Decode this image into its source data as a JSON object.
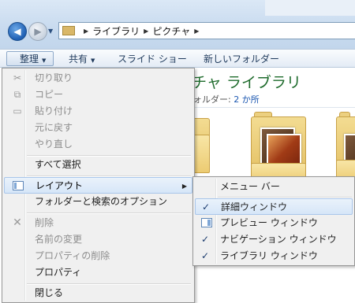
{
  "address": {
    "breadcrumbs": [
      "ライブラリ",
      "ピクチャ"
    ]
  },
  "toolbar": {
    "organize": "整理",
    "share": "共有",
    "slideshow": "スライド ショー",
    "new_folder": "新しいフォルダー"
  },
  "library": {
    "title": "チャ ライブラリ",
    "subtitle_prefix": "ォルダー: ",
    "subtitle_link": "2 か所"
  },
  "menu": {
    "cut": "切り取り",
    "copy": "コピー",
    "paste": "貼り付け",
    "undo": "元に戻す",
    "redo": "やり直し",
    "select_all": "すべて選択",
    "layout": "レイアウト",
    "folder_options": "フォルダーと検索のオプション",
    "delete": "削除",
    "rename": "名前の変更",
    "remove_properties": "プロパティの削除",
    "properties": "プロパティ",
    "close": "閉じる"
  },
  "layout_submenu": {
    "menu_bar": "メニュー バー",
    "details_pane": "詳細ウィンドウ",
    "preview_pane": "プレビュー ウィンドウ",
    "navigation_pane": "ナビゲーション ウィンドウ",
    "library_pane": "ライブラリ ウィンドウ",
    "check_glyph": "✓"
  },
  "colors": {
    "highlight": "#d6e6f8",
    "library_title": "#1e6b2c",
    "link": "#1a56b0"
  }
}
